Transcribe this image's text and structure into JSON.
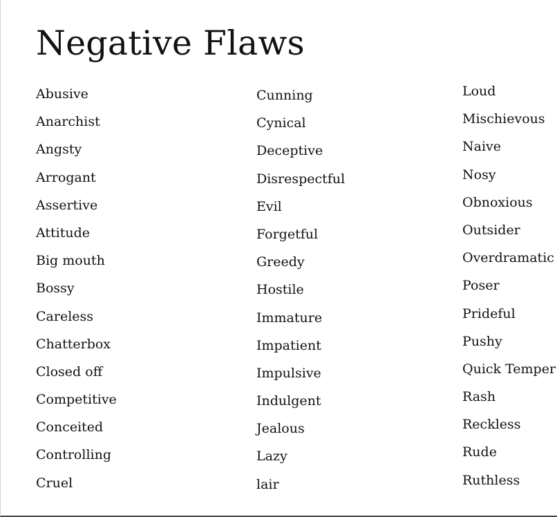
{
  "title": "Negative Flaws",
  "columns": [
    [
      "Abusive",
      "Anarchist",
      "Angsty",
      "Arrogant",
      "Assertive",
      "Attitude",
      "Big mouth",
      "Bossy",
      "Careless",
      "Chatterbox",
      "Closed off",
      "Competitive",
      "Conceited",
      "Controlling",
      "Cruel"
    ],
    [
      "Cunning",
      "Cynical",
      "Deceptive",
      "Disrespectful",
      "Evil",
      "Forgetful",
      "Greedy",
      "Hostile",
      "Immature",
      "Impatient",
      "Impulsive",
      "Indulgent",
      "Jealous",
      "Lazy",
      "lair"
    ],
    [
      "Loud",
      "Mischievous",
      "Naive",
      "Nosy",
      "Obnoxious",
      "Outsider",
      "Overdramatic",
      "Poser",
      "Prideful",
      "Pushy",
      "Quick Temper",
      "Rash",
      "Reckless",
      "Rude",
      "Ruthless"
    ]
  ]
}
